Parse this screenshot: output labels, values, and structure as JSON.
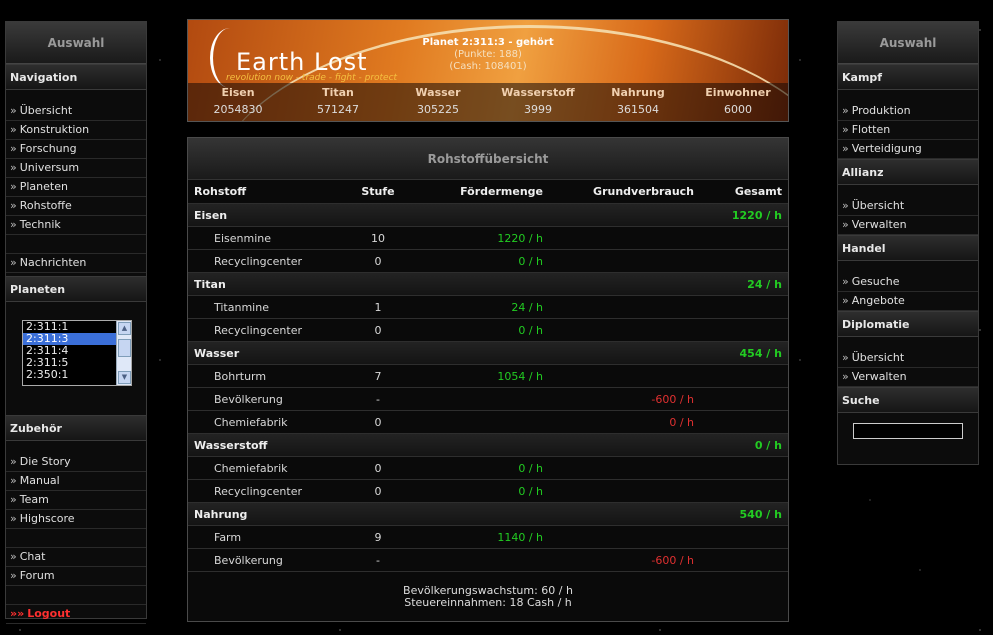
{
  "left": {
    "title": "Auswahl",
    "navigation_head": "Navigation",
    "nav_items": [
      "Übersicht",
      "Konstruktion",
      "Forschung",
      "Universum",
      "Planeten",
      "Rohstoffe",
      "Technik"
    ],
    "nachrichten": "Nachrichten",
    "planeten_head": "Planeten",
    "planet_options": [
      "2:311:1",
      "2:311:3",
      "2:311:4",
      "2:311:5",
      "2:350:1"
    ],
    "planet_selected_index": 1,
    "zubehoer_head": "Zubehör",
    "zubehoer_items": [
      "Die Story",
      "Manual",
      "Team",
      "Highscore"
    ],
    "extra_items": [
      "Chat",
      "Forum"
    ],
    "logout": "Logout",
    "arrow": "»",
    "logout_arrow": "»»"
  },
  "right": {
    "title": "Auswahl",
    "kampf_head": "Kampf",
    "kampf_items": [
      "Produktion",
      "Flotten",
      "Verteidigung"
    ],
    "allianz_head": "Allianz",
    "allianz_items": [
      "Übersicht",
      "Verwalten"
    ],
    "handel_head": "Handel",
    "handel_items": [
      "Gesuche",
      "Angebote"
    ],
    "diplomatie_head": "Diplomatie",
    "diplomatie_items": [
      "Übersicht",
      "Verwalten"
    ],
    "suche_head": "Suche",
    "search_value": ""
  },
  "banner": {
    "brand": "Earth Lost",
    "tagline": "revolution now - trade - fight - protect",
    "planet_name": "Planet 2:311:3 - gehört",
    "points": "(Punkte: 188)",
    "cash": "(Cash: 108401)",
    "resources": [
      {
        "name": "Eisen",
        "value": "2054830"
      },
      {
        "name": "Titan",
        "value": "571247"
      },
      {
        "name": "Wasser",
        "value": "305225"
      },
      {
        "name": "Wasserstoff",
        "value": "3999"
      },
      {
        "name": "Nahrung",
        "value": "361504"
      },
      {
        "name": "Einwohner",
        "value": "6000"
      }
    ]
  },
  "main": {
    "title": "Rohstoffübersicht",
    "columns": [
      "Rohstoff",
      "Stufe",
      "Fördermenge",
      "Grundverbrauch",
      "Gesamt"
    ],
    "rows": [
      {
        "type": "group",
        "name": "Eisen",
        "total": "1220 / h"
      },
      {
        "type": "item",
        "name": "Eisenmine",
        "level": "10",
        "output": "1220 / h",
        "usage": ""
      },
      {
        "type": "item",
        "name": "Recyclingcenter",
        "level": "0",
        "output": "0 / h",
        "usage": ""
      },
      {
        "type": "group",
        "name": "Titan",
        "total": "24 / h"
      },
      {
        "type": "item",
        "name": "Titanmine",
        "level": "1",
        "output": "24 / h",
        "usage": ""
      },
      {
        "type": "item",
        "name": "Recyclingcenter",
        "level": "0",
        "output": "0 / h",
        "usage": ""
      },
      {
        "type": "group",
        "name": "Wasser",
        "total": "454 / h"
      },
      {
        "type": "item",
        "name": "Bohrturm",
        "level": "7",
        "output": "1054 / h",
        "usage": ""
      },
      {
        "type": "item",
        "name": "Bevölkerung",
        "level": "-",
        "output": "",
        "usage": "-600 / h"
      },
      {
        "type": "item",
        "name": "Chemiefabrik",
        "level": "0",
        "output": "",
        "usage": "0 / h"
      },
      {
        "type": "group",
        "name": "Wasserstoff",
        "total": "0 / h"
      },
      {
        "type": "item",
        "name": "Chemiefabrik",
        "level": "0",
        "output": "0 / h",
        "usage": ""
      },
      {
        "type": "item",
        "name": "Recyclingcenter",
        "level": "0",
        "output": "0 / h",
        "usage": ""
      },
      {
        "type": "group",
        "name": "Nahrung",
        "total": "540 / h"
      },
      {
        "type": "item",
        "name": "Farm",
        "level": "9",
        "output": "1140 / h",
        "usage": ""
      },
      {
        "type": "item",
        "name": "Bevölkerung",
        "level": "-",
        "output": "",
        "usage": "-600 / h"
      }
    ],
    "footer_growth": "Bevölkerungswachstum: 60 / h",
    "footer_tax": "Steuereinnahmen: 18 Cash / h"
  },
  "colors": {
    "positive": "#22cc22",
    "negative": "#e03030",
    "logout": "#ff3030"
  }
}
